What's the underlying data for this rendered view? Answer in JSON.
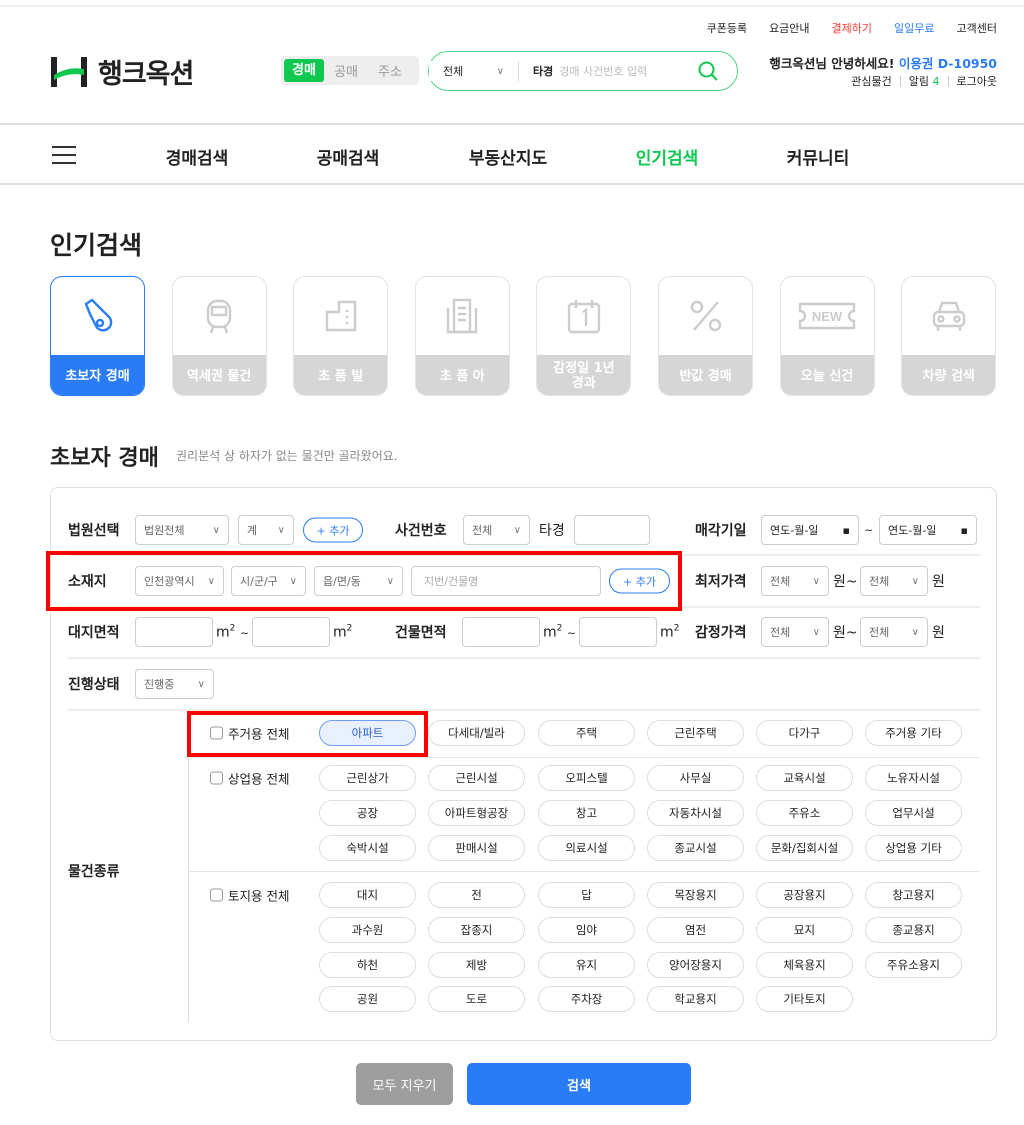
{
  "top_links": [
    "쿠폰등록",
    "요금안내",
    "결제하기",
    "일일무료",
    "고객센터"
  ],
  "logo": "행크옥션",
  "search_tabs": [
    "경매",
    "공매",
    "주소"
  ],
  "search": {
    "scope": "전체",
    "prefix": "타경",
    "placeholder": "경매 사건번호 입력"
  },
  "user": {
    "greeting": "행크옥션님 안녕하세요!",
    "pass_label": "이용권",
    "pass_value": "D-10950",
    "links": {
      "watch": "관심물건",
      "alarm": "알림",
      "alarm_count": "4",
      "logout": "로그아웃"
    }
  },
  "nav": [
    "경매검색",
    "공매검색",
    "부동산지도",
    "인기검색",
    "커뮤니티"
  ],
  "page_title": "인기검색",
  "categories": [
    "초보자 경매",
    "역세권 물건",
    "초 품 빌",
    "초 품 아",
    "감정일 1년 경과",
    "반값 경매",
    "오늘 신건",
    "차량 검색"
  ],
  "section": {
    "title": "초보자 경매",
    "subtitle": "권리분석 상 하자가 없는 물건만 골라왔어요."
  },
  "form": {
    "court": {
      "label": "법원선택",
      "court": "법원전체",
      "branch": "계",
      "add": "+ 추가"
    },
    "case": {
      "label": "사건번호",
      "year": "전체",
      "mid": "타경"
    },
    "sale_date": {
      "label": "매각기일",
      "from": "연도-월-일",
      "tilde": "~",
      "to": "연도-월-일"
    },
    "location": {
      "label": "소재지",
      "sido": "인천광역시",
      "sigungu": "시/군/구",
      "dong": "읍/면/동",
      "placeholder": "지번/건물명",
      "add": "+ 추가"
    },
    "min_price": {
      "label": "최저가격",
      "from": "전체",
      "to": "전체",
      "won_tilde": "원~",
      "won": "원"
    },
    "land_area": {
      "label": "대지면적",
      "unit": "m",
      "tilde": "~"
    },
    "bldg_area": {
      "label": "건물면적"
    },
    "appraisal": {
      "label": "감정가격",
      "from": "전체",
      "to": "전체"
    },
    "status": {
      "label": "진행상태",
      "value": "진행중"
    },
    "type_label": "물건종류",
    "groups": [
      {
        "all": "주거용 전체",
        "items": [
          "아파트",
          "다세대/빌라",
          "주택",
          "근린주택",
          "다가구",
          "주거용 기타"
        ]
      },
      {
        "all": "상업용 전체",
        "items": [
          "근린상가",
          "근린시설",
          "오피스텔",
          "사무실",
          "교육시설",
          "노유자시설",
          "공장",
          "아파트형공장",
          "창고",
          "자동차시설",
          "주유소",
          "업무시설",
          "숙박시설",
          "판매시설",
          "의료시설",
          "종교시설",
          "문화/집회시설",
          "상업용 기타"
        ]
      },
      {
        "all": "토지용 전체",
        "items": [
          "대지",
          "전",
          "답",
          "목장용지",
          "공장용지",
          "창고용지",
          "과수원",
          "잡종지",
          "임야",
          "염전",
          "묘지",
          "종교용지",
          "하천",
          "제방",
          "유지",
          "양어장용지",
          "체육용지",
          "주유소용지",
          "공원",
          "도로",
          "주차장",
          "학교용지",
          "기타토지"
        ]
      }
    ]
  },
  "buttons": {
    "clear": "모두 지우기",
    "search": "검색"
  },
  "colors": {
    "green": "#10c850",
    "blue": "#2a7cf6",
    "red": "#ff3b30"
  }
}
